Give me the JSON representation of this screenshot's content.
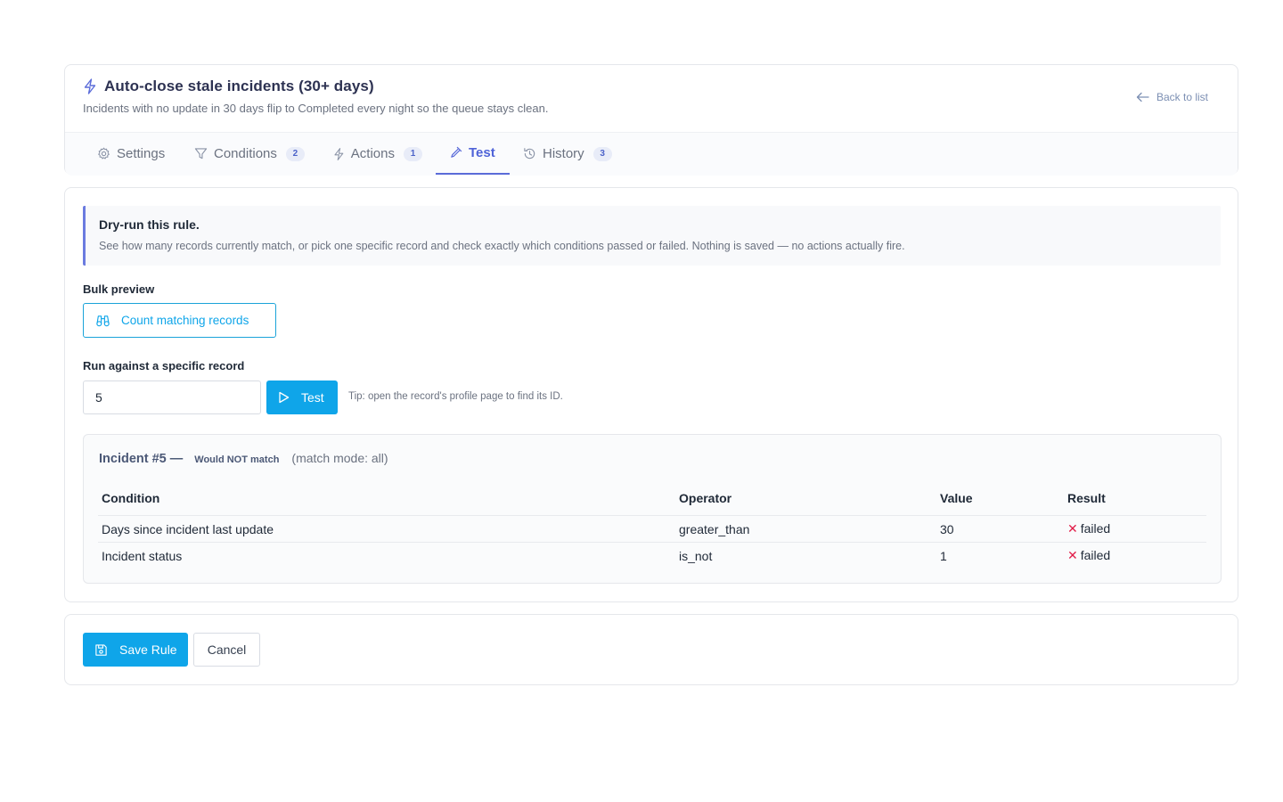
{
  "header": {
    "title": "Auto-close stale incidents (30+ days)",
    "subtitle": "Incidents with no update in 30 days flip to Completed every night so the queue stays clean.",
    "back_label": "Back to list"
  },
  "tabs": [
    {
      "label": "Settings",
      "badge": "",
      "icon": "gear-icon"
    },
    {
      "label": "Conditions",
      "badge": "2",
      "icon": "filter-icon"
    },
    {
      "label": "Actions",
      "badge": "1",
      "icon": "bolt-icon"
    },
    {
      "label": "Test",
      "badge": "",
      "icon": "beaker-icon",
      "active": true
    },
    {
      "label": "History",
      "badge": "3",
      "icon": "history-icon"
    }
  ],
  "info": {
    "title": "Dry-run this rule.",
    "text": "See how many records currently match, or pick one specific record and check exactly which conditions passed or failed. Nothing is saved — no actions actually fire."
  },
  "bulk": {
    "label": "Bulk preview",
    "button": "Count matching records"
  },
  "specific": {
    "label": "Run against a specific record",
    "input_value": "5",
    "button": "Test",
    "tip": "Tip: open the record's profile page to find its ID."
  },
  "result": {
    "title": "Incident #5 —",
    "status": "Would NOT match",
    "mode": "(match mode: all)",
    "columns": [
      "Condition",
      "Operator",
      "Value",
      "Result"
    ],
    "rows": [
      {
        "condition": "Days since incident last update",
        "operator": "greater_than",
        "value": "30",
        "result": "failed"
      },
      {
        "condition": "Incident status",
        "operator": "is_not",
        "value": "1",
        "result": "failed"
      }
    ]
  },
  "footer": {
    "save_label": "Save Rule",
    "cancel_label": "Cancel"
  },
  "colors": {
    "accent": "#0fa5e9",
    "tab_active": "#4f63d8",
    "fail": "#e11d48"
  }
}
